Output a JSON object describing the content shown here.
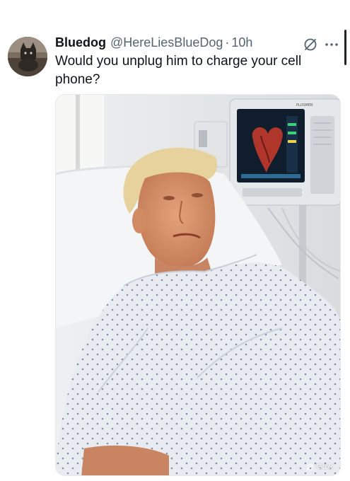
{
  "post": {
    "display_name": "Bluedog",
    "handle": "@HereLiesBlueDog",
    "separator": "·",
    "time": "10h",
    "text": "Would you unplug him to charge your cell phone?"
  },
  "icons": {
    "grok": "grok-icon",
    "more": "more-icon"
  },
  "media": {
    "watermark": "Grok",
    "monitor_label": "PLUSMEN"
  },
  "colors": {
    "text_primary": "#0f1419",
    "text_secondary": "#536471"
  }
}
